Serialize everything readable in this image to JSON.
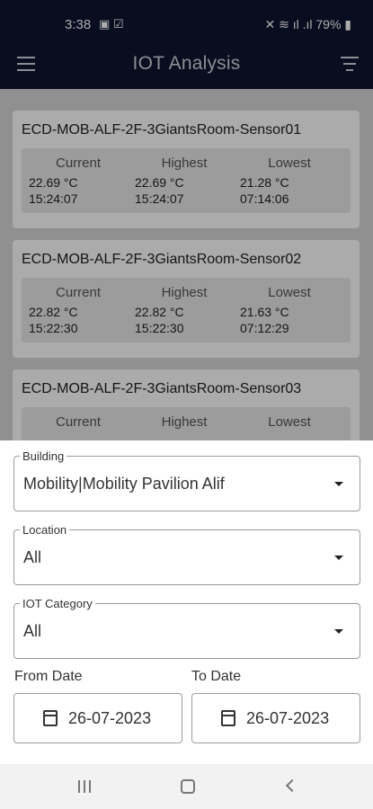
{
  "status": {
    "time": "3:38",
    "battery": "79%"
  },
  "appbar": {
    "title": "IOT Analysis"
  },
  "columns": {
    "current": "Current",
    "highest": "Highest",
    "lowest": "Lowest"
  },
  "sensors": [
    {
      "name": "ECD-MOB-ALF-2F-3GiantsRoom-Sensor01",
      "current": {
        "value": "22.69 °C",
        "time": "15:24:07"
      },
      "highest": {
        "value": "22.69 °C",
        "time": "15:24:07"
      },
      "lowest": {
        "value": "21.28 °C",
        "time": "07:14:06"
      }
    },
    {
      "name": "ECD-MOB-ALF-2F-3GiantsRoom-Sensor02",
      "current": {
        "value": "22.82 °C",
        "time": "15:22:30"
      },
      "highest": {
        "value": "22.82 °C",
        "time": "15:22:30"
      },
      "lowest": {
        "value": "21.63 °C",
        "time": "07:12:29"
      }
    },
    {
      "name": "ECD-MOB-ALF-2F-3GiantsRoom-Sensor03"
    }
  ],
  "filters": {
    "building": {
      "label": "Building",
      "value": "Mobility|Mobility Pavilion Alif"
    },
    "location": {
      "label": "Location",
      "value": "All"
    },
    "category": {
      "label": "IOT Category",
      "value": "All"
    },
    "from_date": {
      "label": "From Date",
      "value": "26-07-2023"
    },
    "to_date": {
      "label": "To Date",
      "value": "26-07-2023"
    }
  }
}
